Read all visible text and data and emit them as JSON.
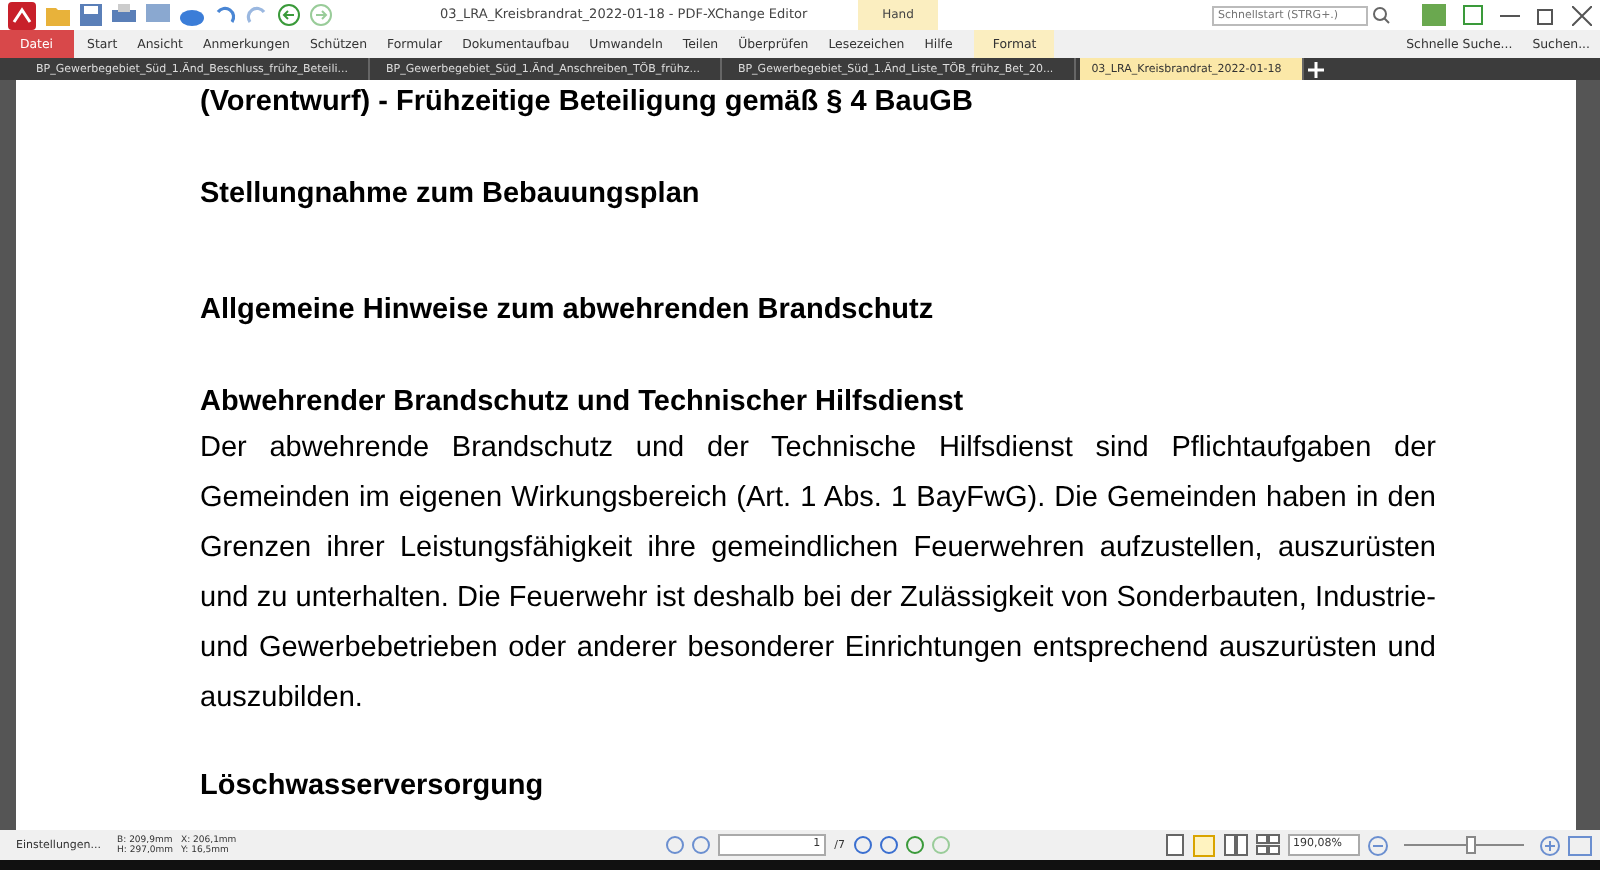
{
  "window": {
    "title": "03_LRA_Kreisbrandrat_2022-01-18 - PDF-XChange Editor",
    "context_tab": "Hand"
  },
  "quick_launch": {
    "placeholder": "Schnellstart (STRG+.)"
  },
  "menu": [
    {
      "label": "Datei",
      "kind": "file"
    },
    {
      "label": "Start",
      "kind": "menu"
    },
    {
      "label": "Ansicht",
      "kind": "menu"
    },
    {
      "label": "Anmerkungen",
      "kind": "menu"
    },
    {
      "label": "Schützen",
      "kind": "menu"
    },
    {
      "label": "Formular",
      "kind": "menu"
    },
    {
      "label": "Dokumentaufbau",
      "kind": "menu"
    },
    {
      "label": "Umwandeln",
      "kind": "menu"
    },
    {
      "label": "Teilen",
      "kind": "menu"
    },
    {
      "label": "Überprüfen",
      "kind": "menu"
    },
    {
      "label": "Lesezeichen",
      "kind": "menu"
    },
    {
      "label": "Hilfe",
      "kind": "menu"
    },
    {
      "label": "Format",
      "kind": "context"
    }
  ],
  "menu_right": [
    "Schnelle Suche...",
    "Suchen..."
  ],
  "tabs": [
    {
      "label": "BP_Gewerbegebiet_Süd_1.Änd_Beschluss_frühz_Beteili...",
      "selected": false
    },
    {
      "label": "BP_Gewerbegebiet_Süd_1.Änd_Anschreiben_TÖB_frühz...",
      "selected": false
    },
    {
      "label": "BP_Gewerbegebiet_Süd_1.Änd_Liste_TÖB_frühz_Bet_20...",
      "selected": false
    },
    {
      "label": "03_LRA_Kreisbrandrat_2022-01-18",
      "selected": true
    }
  ],
  "document": [
    {
      "kind": "heading",
      "text": "(Vorentwurf) - Frühzeitige Beteiligung gemäß § 4 BauGB"
    },
    {
      "kind": "heading",
      "text": "Stellungnahme zum Bebauungsplan"
    },
    {
      "kind": "heading",
      "text": "Allgemeine Hinweise zum abwehrenden Brandschutz"
    },
    {
      "kind": "subheading",
      "text": "Abwehrender Brandschutz und Technischer Hilfsdienst"
    },
    {
      "kind": "paragraph",
      "text": "Der abwehrende Brandschutz und der Technische Hilfsdienst sind Pflichtaufgaben der Gemeinden im eigenen Wirkungsbereich (Art. 1 Abs. 1 BayFwG). Die Gemeinden haben in den Grenzen ihrer Leistungsfähigkeit ihre gemeindlichen Feuerwehren aufzustellen, auszurüsten und zu unterhalten. Die Feuerwehr ist deshalb bei der Zulässigkeit von Sonderbauten, Industrie- und Gewerbebetrieben oder anderer besonderer Einrichtungen entsprechend auszurüsten und auszubilden."
    },
    {
      "kind": "subheading",
      "text": "Löschwasserversorgung"
    }
  ],
  "status_bar": {
    "settings": "Einstellungen...",
    "size_w": "B: 209,9mm",
    "size_h": "H: 297,0mm",
    "pos_x": "X: 206,1mm",
    "pos_y": "Y: 16,5mm",
    "page": "1",
    "page_count": "/7",
    "zoom": "190,08%",
    "zoom_slider": {
      "level": 0.55
    }
  }
}
